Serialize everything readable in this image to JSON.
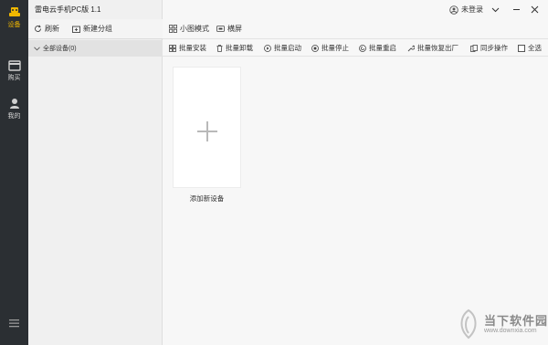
{
  "app": {
    "title": "雷电云手机PC版 1.1"
  },
  "nav": {
    "items": [
      {
        "label": "设备",
        "icon": "device-icon",
        "active": true
      },
      {
        "label": "购买",
        "icon": "purchase-icon",
        "active": false
      },
      {
        "label": "我的",
        "icon": "profile-icon",
        "active": false
      }
    ],
    "menu_icon": "hamburger-icon"
  },
  "sidebar": {
    "refresh_label": "刷新",
    "new_group_label": "新建分组",
    "group_name": "全部设备(0)"
  },
  "view": {
    "small_mode_label": "小图模式",
    "landscape_label": "横屏"
  },
  "batch": {
    "install": "批量安装",
    "uninstall": "批量卸载",
    "start": "批量启动",
    "stop": "批量停止",
    "restart": "批量重启",
    "reset": "批量恢复出厂",
    "sync": "同步操作",
    "select_all": "全选"
  },
  "devices": {
    "add_label": "添加新设备"
  },
  "account": {
    "login_label": "未登录"
  },
  "watermark": {
    "title": "当下软件园",
    "url": "www.downxia.com"
  },
  "colors": {
    "nav_bg": "#2b2f33",
    "accent": "#f0b800"
  }
}
